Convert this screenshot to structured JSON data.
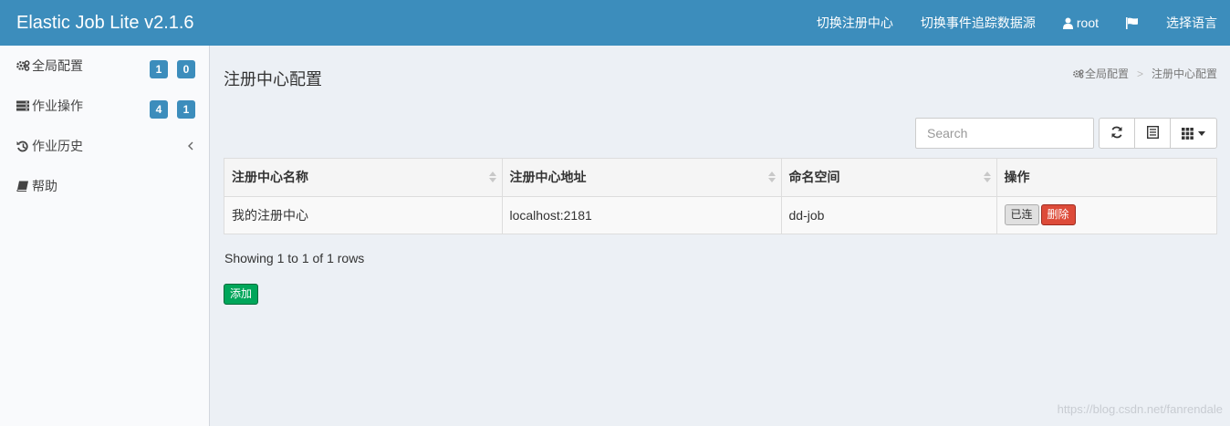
{
  "header": {
    "brand": "Elastic Job Lite v2.1.6",
    "nav": {
      "switch_registry": "切换注册中心",
      "switch_datasource": "切换事件追踪数据源",
      "user": "root",
      "language": "选择语言"
    }
  },
  "sidebar": {
    "items": [
      {
        "label": "全局配置",
        "badges": [
          "1",
          "0"
        ]
      },
      {
        "label": "作业操作",
        "badges": [
          "4",
          "1"
        ]
      },
      {
        "label": "作业历史"
      },
      {
        "label": "帮助"
      }
    ]
  },
  "main": {
    "title": "注册中心配置",
    "breadcrumb": {
      "parent": "全局配置",
      "current": "注册中心配置"
    },
    "search_placeholder": "Search",
    "table": {
      "headers": [
        "注册中心名称",
        "注册中心地址",
        "命名空间",
        "操作"
      ],
      "rows": [
        {
          "name": "我的注册中心",
          "address": "localhost:2181",
          "namespace": "dd-job",
          "actions": {
            "connected": "已连",
            "delete": "删除"
          }
        }
      ]
    },
    "pagination_info": "Showing 1 to 1 of 1 rows",
    "add_button": "添加"
  },
  "watermark": "https://blog.csdn.net/fanrendale",
  "colors": {
    "header_bg": "#3c8dbc",
    "badge": "#3c8dbc",
    "delete_button": "#dd4b39",
    "add_button": "#00a65a"
  }
}
